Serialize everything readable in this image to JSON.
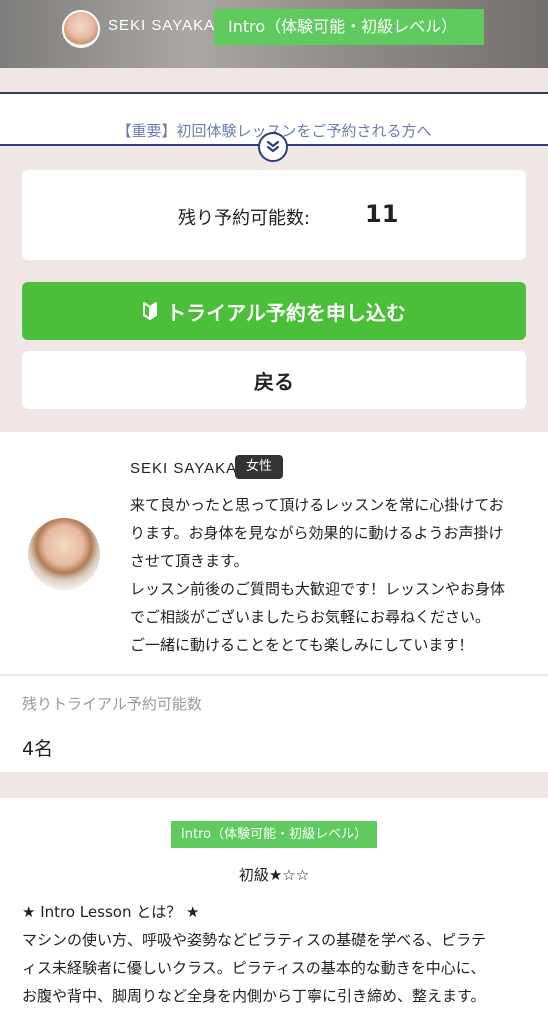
{
  "hero": {
    "instructor_name": "SEKI SAYAKA",
    "class_tag": "Intro（体験可能・初級レベル）"
  },
  "notice": {
    "text": "【重要】初回体験レッスンをご予約される方へ",
    "chevron_icon": "double-chevron-down-icon"
  },
  "reservation": {
    "remaining_label": "残り予約可能数:",
    "remaining_value": "11",
    "trial_button": "トライアル予約を申し込む",
    "trial_icon": "beginner-leaf-icon",
    "back_button": "戻る"
  },
  "instructor": {
    "name": "SEKI SAYAKA",
    "gender": "女性",
    "bio_lines": [
      "来て良かったと思って頂けるレッスンを常に心掛けてお",
      "ります。お身体を見ながら効果的に動けるようお声掛け",
      "させて頂きます。",
      "レッスン前後のご質問も大歓迎です！レッスンやお身体",
      "でご相談がございましたらお気軽にお尋ねください。",
      "ご一緒に動けることをとても楽しみにしています！"
    ]
  },
  "trial_availability": {
    "label": "残りトライアル予約可能数",
    "value": "4名"
  },
  "lesson": {
    "level_tag": "Intro（体験可能・初級レベル）",
    "level": "初級★☆☆",
    "description_lines": [
      "★ Intro Lesson とは？ ★",
      "マシンの使い方、呼吸や姿勢などピラティスの基礎を学べる、ピラテ",
      "ィス未経験者に優しいクラス。ピラティスの基本的な動きを中心に、",
      "お腹や背中、脚周りなど全身を内側から丁寧に引き締め、整えます。"
    ]
  },
  "colors": {
    "accent_green": "#4cbf3a",
    "tag_green": "#5fcb5e",
    "navy": "#2f3c7e",
    "beige_bg": "#f0e6e5"
  }
}
